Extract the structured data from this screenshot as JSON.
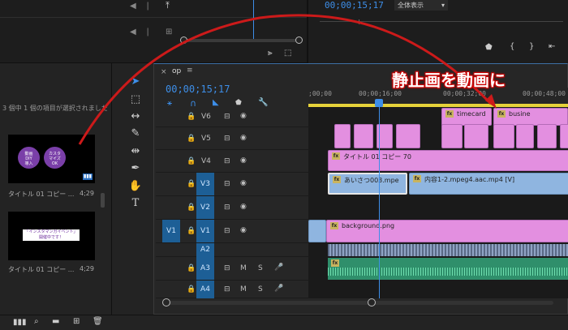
{
  "source": {
    "timecode": "00;00;15;17",
    "zoom_select": "全体表示"
  },
  "project": {
    "status_text": "3 個中 1 個の項目が選択されました",
    "items": [
      {
        "name": "タイトル 01 コピー ...",
        "duration": "4;29",
        "circle1": "動画\nDIY\n導入",
        "circle2": "カスタ\nマイズ\nOK"
      },
      {
        "name": "タイトル 01 コピー ...",
        "duration": "4;29",
        "banner": "「インスタマンガイベント」\n開催中です！"
      }
    ]
  },
  "timeline": {
    "tab_label": "op",
    "timecode": "00;00;15;17",
    "ruler_ticks": [
      ";00;00",
      "00;00;16;00",
      "00;00;32;00",
      "00;00;48;00"
    ],
    "tracks": [
      {
        "id": "V6"
      },
      {
        "id": "V5"
      },
      {
        "id": "V4"
      },
      {
        "id": "V3"
      },
      {
        "id": "V2"
      },
      {
        "id": "V1",
        "source": "V1"
      },
      {
        "id": "A2"
      },
      {
        "id": "A3"
      },
      {
        "id": "A4"
      }
    ],
    "mute_label": "M",
    "solo_label": "S",
    "clips": {
      "timecard": "timecard",
      "busine": "busine",
      "title_copy": "タイトル 01 コピー 70",
      "aisatsu": "あいさつ003.mpe",
      "naiyou": "内容1-2.mpeg4.aac.mp4 [V]",
      "background": "background.png",
      "fx": "fx"
    }
  },
  "callout": {
    "text": "静止画を動画に",
    "arrow_color": "#cc1a1a"
  }
}
